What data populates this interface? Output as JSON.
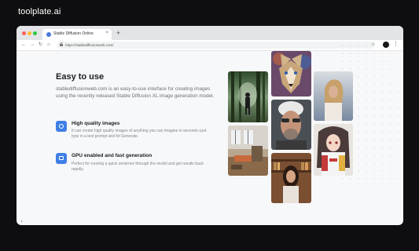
{
  "brand": "toolplate.ai",
  "browser": {
    "tab_title": "Stable Diffusion Online",
    "tab_close": "×",
    "new_tab": "+",
    "url": "https://stablediffusionweb.com/",
    "back": "←",
    "forward": "→",
    "reload": "↻",
    "home": "⌂",
    "star": "☆",
    "menu": "⋮"
  },
  "section": {
    "title": "Easy to use",
    "description": "stablediffusionweb.com is an easy-to-use interface for creating images using the recently released Stable Diffusion XL image generation model."
  },
  "features": [
    {
      "title": "High quality images",
      "description": "It can create high quality images of anything you can imagine in seconds–just type in a text prompt and hit Generate.",
      "icon": "image-icon"
    },
    {
      "title": "GPU enabled and fast generation",
      "description": "Perfect for running a quick sentence through the model and get results back rapidly.",
      "icon": "gpu-icon"
    }
  ],
  "gallery": [
    {
      "subject": "forest-figure",
      "color": "#4f6a45"
    },
    {
      "subject": "interior-room",
      "color": "#9c8367"
    },
    {
      "subject": "wolf",
      "color": "#8a6a5a"
    },
    {
      "subject": "man-portrait",
      "color": "#6d6b6e"
    },
    {
      "subject": "woman-library",
      "color": "#8b5e3c"
    },
    {
      "subject": "woman-beach",
      "color": "#b4b9c0"
    },
    {
      "subject": "anime-girl",
      "color": "#c24a4a"
    }
  ]
}
